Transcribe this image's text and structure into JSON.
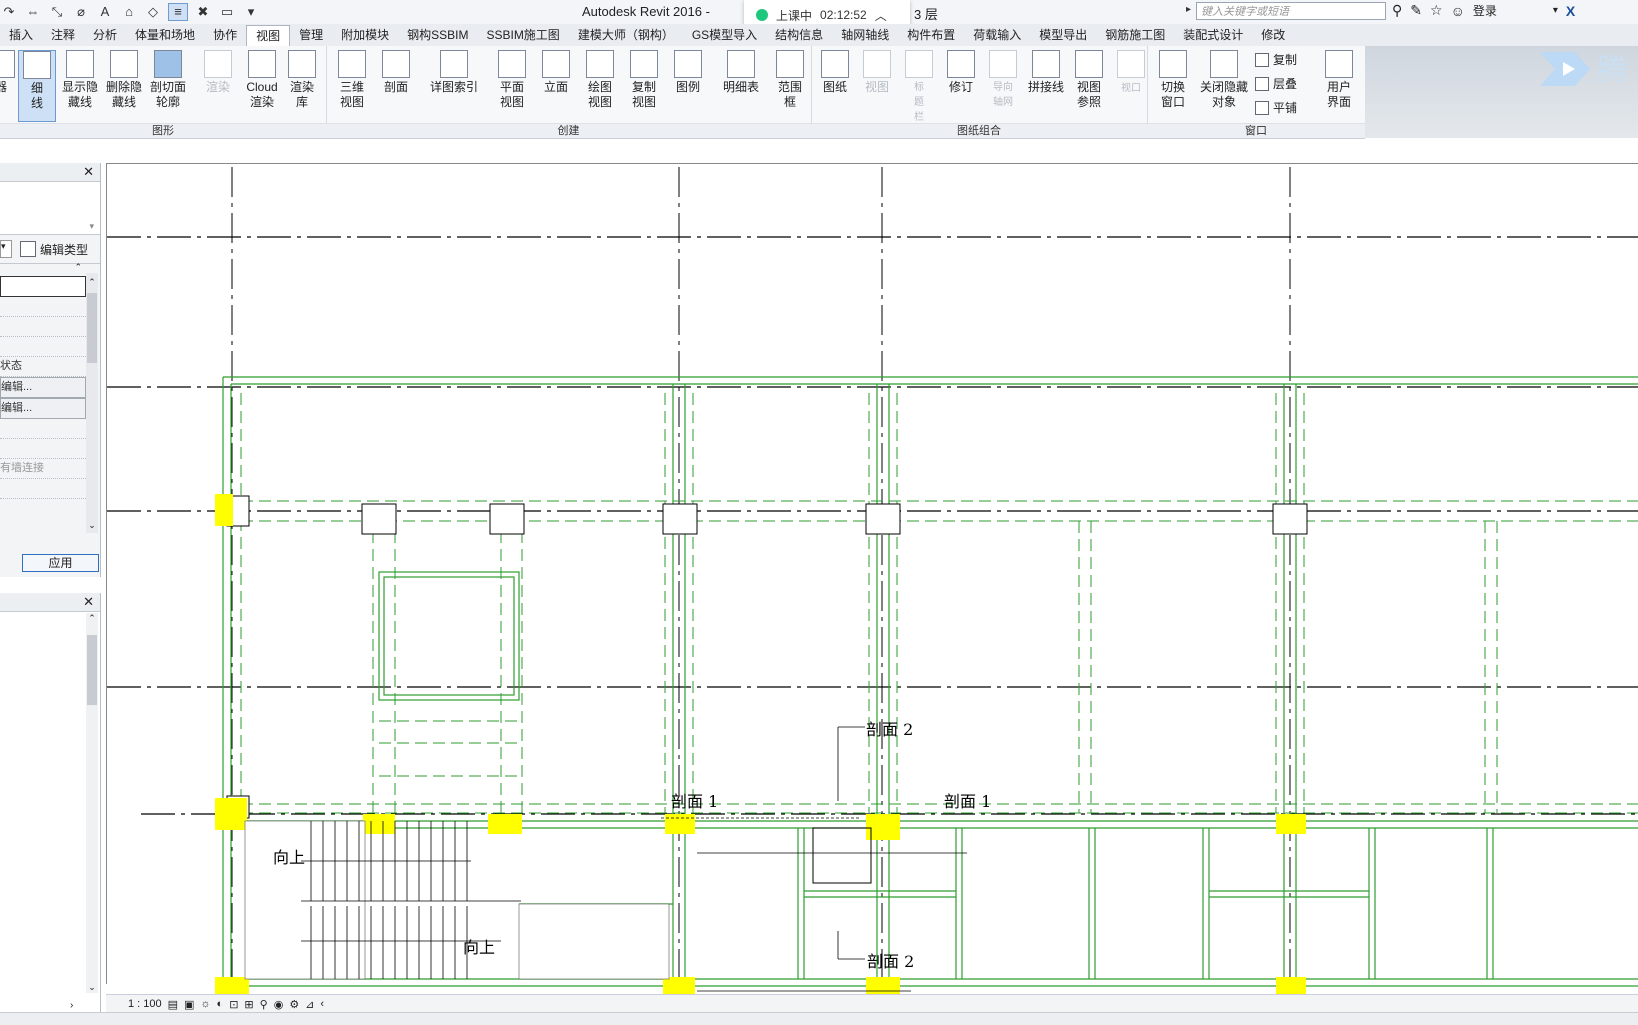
{
  "titlebar": {
    "app_title": "Autodesk Revit 2016 -",
    "recording_status": "上课中",
    "recording_time": "02:12:52",
    "view_name": "3 层",
    "search_placeholder": "键入关键字或短语",
    "login": "登录"
  },
  "tabs": [
    "插入",
    "注释",
    "分析",
    "体量和场地",
    "协作",
    "视图",
    "管理",
    "附加模块",
    "钢构SSBIM",
    "SSBIM施工图",
    "建模大师（钢构）",
    "GS模型导入",
    "结构信息",
    "轴网轴线",
    "构件布置",
    "荷载输入",
    "模型导出",
    "钢筋施工图",
    "装配式设计",
    "修改"
  ],
  "active_tab": "视图",
  "ribbon": {
    "graphics": {
      "title": "图形",
      "buttons": [
        "器",
        "细线",
        "显示隐藏线",
        "删除隐藏线",
        "剖切面轮廓",
        "渲染",
        "Cloud渲染",
        "渲染库"
      ]
    },
    "create": {
      "title": "创建",
      "buttons": [
        "三维视图",
        "剖面",
        "详图索引",
        "平面视图",
        "立面",
        "绘图视图",
        "复制视图",
        "图例",
        "明细表",
        "范围框"
      ]
    },
    "sheet": {
      "title": "图纸组合",
      "buttons": [
        "图纸",
        "视图",
        "标题栏",
        "修订",
        "导向轴网",
        "拼接线",
        "视图参照",
        "视口"
      ]
    },
    "windows": {
      "title": "窗口",
      "buttons": [
        "切换窗口",
        "关闭隐藏对象"
      ],
      "small": [
        "复制",
        "层叠",
        "平铺"
      ],
      "ui": "用户界面"
    }
  },
  "properties": {
    "edit_type": "编辑类型",
    "rows": [
      "状态",
      "编辑...",
      "编辑...",
      "有墙连接"
    ],
    "apply": "应用"
  },
  "drawing": {
    "labels": [
      "剖面 2",
      "剖面 1",
      "剖面 1",
      "向上",
      "向上",
      "剖面 2"
    ]
  },
  "view_control": {
    "scale": "1 : 100"
  },
  "colors": {
    "column_highlight": "#ffff00",
    "wall_line": "#2f9e2f",
    "grid_line": "#000000"
  }
}
